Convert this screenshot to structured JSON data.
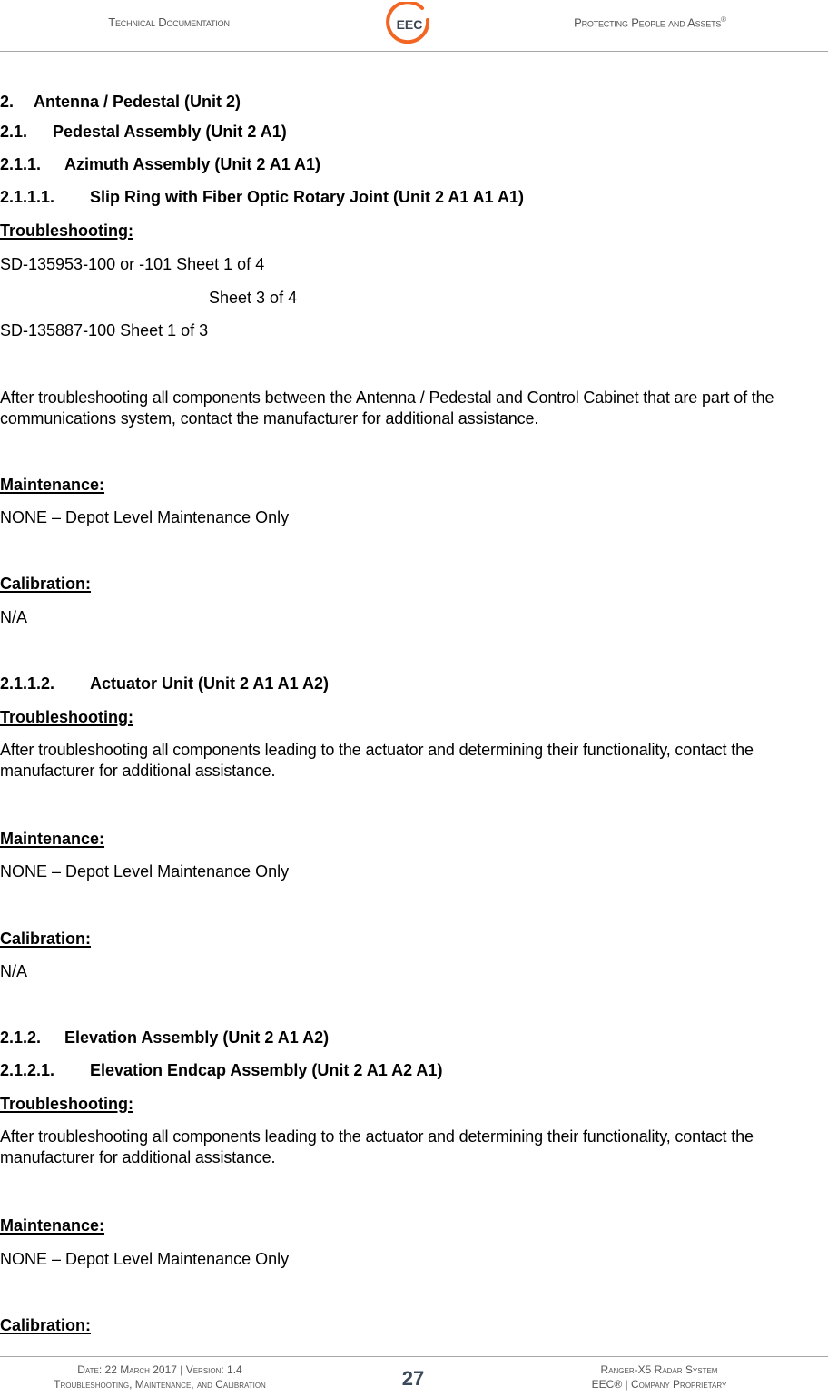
{
  "header": {
    "left": "Technical Documentation",
    "right": "Protecting People and Assets",
    "right_mark": "®",
    "logo_text": "EEC",
    "logo_color": "#f26522",
    "logo_text_color": "#3b4450"
  },
  "sections": {
    "s2": {
      "num": "2.",
      "title": "Antenna / Pedestal (Unit 2)"
    },
    "s21": {
      "num": "2.1.",
      "title": "Pedestal Assembly (Unit 2 A1)"
    },
    "s211": {
      "num": "2.1.1.",
      "title": "Azimuth Assembly (Unit 2 A1 A1)"
    },
    "s2111": {
      "num": "2.1.1.1.",
      "title": "Slip Ring with Fiber Optic Rotary Joint (Unit 2 A1 A1 A1)",
      "troubleshooting_label": "Troubleshooting:",
      "refs": [
        "SD-135953-100 or -101 Sheet 1 of 4",
        "Sheet 3 of 4",
        "SD-135887-100 Sheet 1 of 3"
      ],
      "troubleshooting_text": "After troubleshooting all components between the Antenna / Pedestal and Control Cabinet that are part of the communications system, contact the manufacturer for additional assistance.",
      "maintenance_label": "Maintenance:",
      "maintenance_text": "NONE – Depot Level Maintenance Only",
      "calibration_label": "Calibration:",
      "calibration_text": "N/A"
    },
    "s2112": {
      "num": "2.1.1.2.",
      "title": "Actuator Unit (Unit 2 A1 A1 A2)",
      "troubleshooting_label": "Troubleshooting:",
      "troubleshooting_text": "After troubleshooting all components leading to the actuator and determining their functionality, contact the manufacturer for additional assistance.",
      "maintenance_label": "Maintenance:",
      "maintenance_text": "NONE – Depot Level Maintenance Only",
      "calibration_label": "Calibration:",
      "calibration_text": "N/A"
    },
    "s212": {
      "num": "2.1.2.",
      "title": "Elevation Assembly (Unit 2 A1 A2)"
    },
    "s2121": {
      "num": "2.1.2.1.",
      "title": "Elevation Endcap Assembly (Unit 2 A1 A2 A1)",
      "troubleshooting_label": "Troubleshooting:",
      "troubleshooting_text": "After troubleshooting all components leading to the actuator and determining their functionality, contact the manufacturer for additional assistance.",
      "maintenance_label": "Maintenance:",
      "maintenance_text": "NONE – Depot Level Maintenance Only",
      "calibration_label": "Calibration:"
    }
  },
  "footer": {
    "left_line1": "Date: 22 March 2017 | Version: 1.4",
    "left_line2": "Troubleshooting, Maintenance, and Calibration",
    "page_number": "27",
    "right_line1": "Ranger-X5 Radar System",
    "right_line2": "EEC® | Company Proprietary"
  }
}
